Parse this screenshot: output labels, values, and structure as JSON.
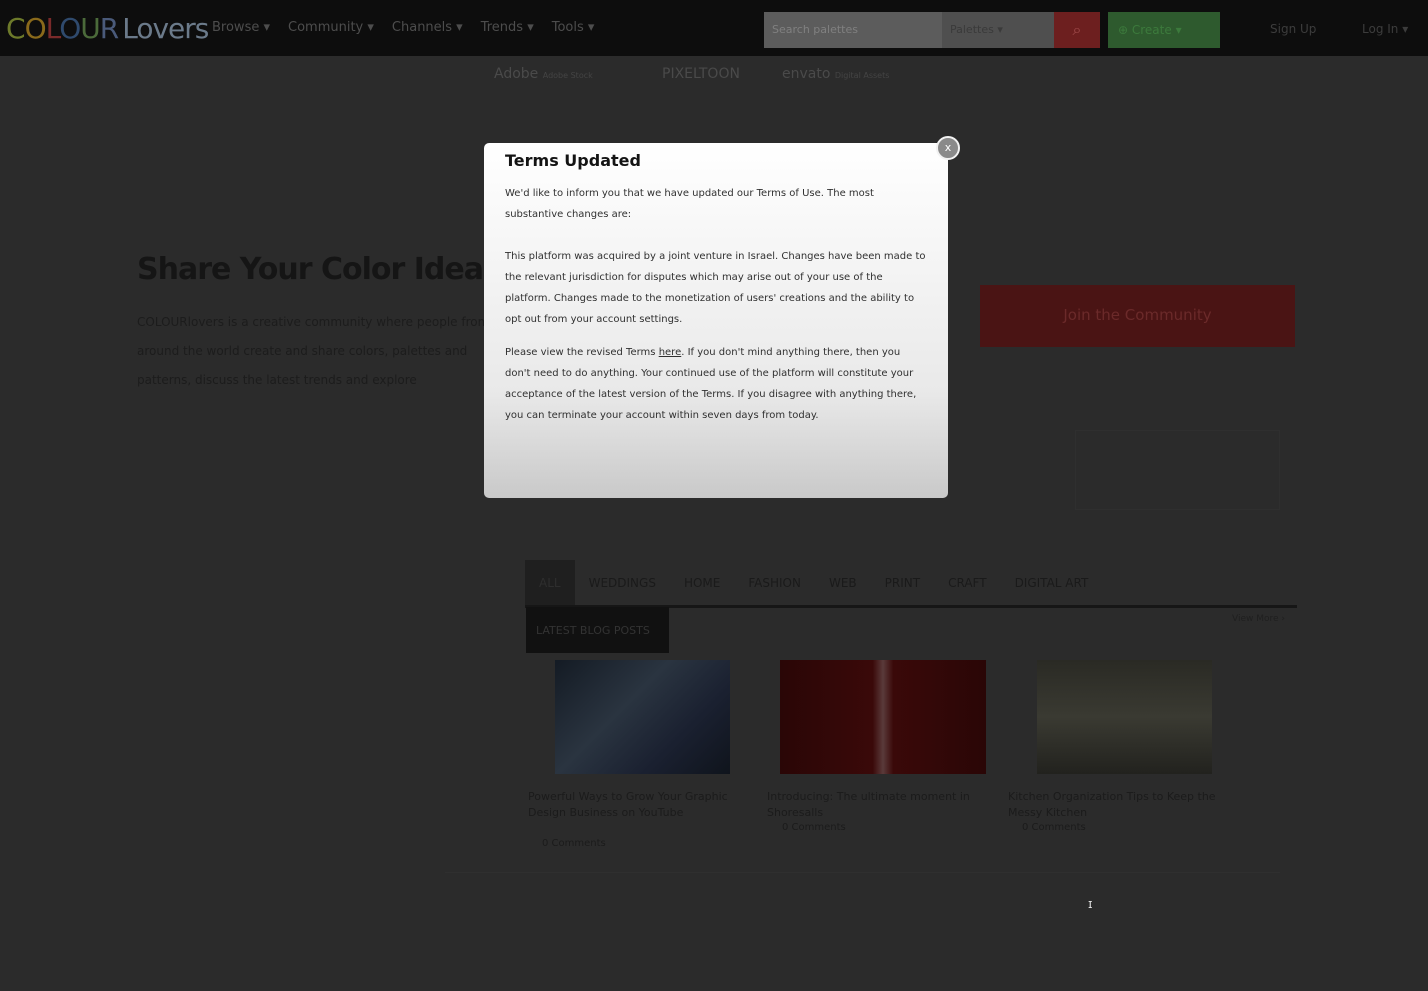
{
  "header": {
    "logo": {
      "c1": "C",
      "c2": "O",
      "c3": "L",
      "c4": "O",
      "c5": "U",
      "c6": "R",
      "lovers": "Lovers"
    },
    "nav": [
      "Browse ▾",
      "Community ▾",
      "Channels ▾",
      "Trends ▾",
      "Tools ▾"
    ],
    "search_placeholder": "Search palettes",
    "search_type": "Palettes ▾",
    "create_label": "Create ▾",
    "sign_up": "Sign Up",
    "log_in": "Log In ▾"
  },
  "sponsors": [
    {
      "name": "Adobe",
      "note": "Adobe Stock"
    },
    {
      "name": "PIXELTOON",
      "note": ""
    },
    {
      "name": "envato",
      "note": "Digital Assets"
    }
  ],
  "hero": {
    "title": "Share Your Color Ideas &",
    "text": "COLOURlovers is a creative community where people from around the world create and share colors, palettes and patterns, discuss the latest trends and explore",
    "join_label": "Join the Community"
  },
  "channels": {
    "tabs": [
      "ALL",
      "WEDDINGS",
      "HOME",
      "FASHION",
      "WEB",
      "PRINT",
      "CRAFT",
      "DIGITAL ART"
    ],
    "latest_label": "LATEST BLOG POSTS",
    "view_more": "View More ›"
  },
  "posts": [
    {
      "title": "Powerful Ways to Grow Your Graphic Design Business on YouTube",
      "meta": "0 Comments"
    },
    {
      "title": "Introducing: The ultimate moment in Shoresalls",
      "meta": "0 Comments"
    },
    {
      "title": "Kitchen Organization Tips to Keep the Messy Kitchen",
      "meta": "0 Comments"
    }
  ],
  "modal": {
    "title": "Terms Updated",
    "p1": "We'd like to inform you that we have updated our Terms of Use. The most substantive changes are:",
    "p2": "This platform was acquired by a joint venture in Israel. Changes have been made to the relevant jurisdiction for disputes which may arise out of your use of the platform. Changes made to the monetization of users' creations and the ability to opt out from your account settings.",
    "p3_before": "Please view the revised Terms ",
    "p3_link": "here",
    "p3_after": ". If you don't mind anything there, then you don't need to do anything. Your continued use of the platform will constitute your acceptance of the latest version of the Terms. If you disagree with anything there, you can terminate your account within seven days from today.",
    "close_label": "x"
  },
  "colors": {
    "join": "#4a1414",
    "create": "#2e5a2e",
    "search_btn": "#6d1f1f"
  }
}
